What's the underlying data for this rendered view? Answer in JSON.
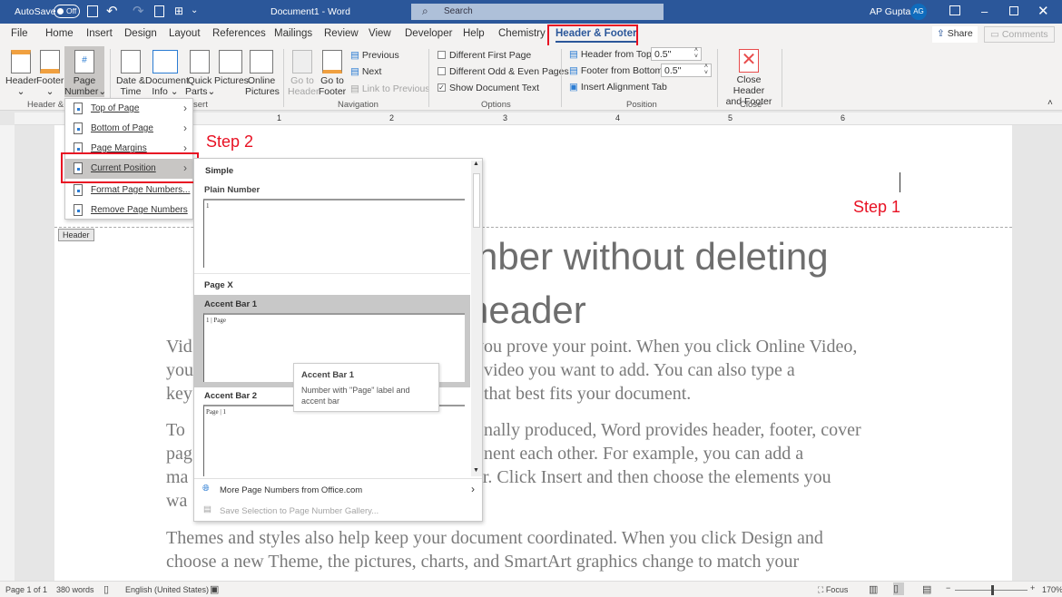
{
  "titlebar": {
    "autosave_label": "AutoSave",
    "autosave_state": "Off",
    "document_title": "Document1  -  Word",
    "search_placeholder": "Search",
    "user_name": "AP Gupta",
    "user_initials": "AG"
  },
  "tabs": [
    "File",
    "Home",
    "Insert",
    "Design",
    "Layout",
    "References",
    "Mailings",
    "Review",
    "View",
    "Developer",
    "Help",
    "Chemistry",
    "Header & Footer"
  ],
  "active_tab": "Header & Footer",
  "share_label": "Share",
  "comments_label": "Comments",
  "ribbon": {
    "header": "Header",
    "footer": "Footer",
    "page_number_1": "Page",
    "page_number_2": "Number",
    "date_time_1": "Date &",
    "date_time_2": "Time",
    "doc_info_1": "Document",
    "doc_info_2": "Info",
    "quick_parts_1": "Quick",
    "quick_parts_2": "Parts",
    "pictures": "Pictures",
    "online_pictures_1": "Online",
    "online_pictures_2": "Pictures",
    "go_header_1": "Go to",
    "go_header_2": "Header",
    "go_footer_1": "Go to",
    "go_footer_2": "Footer",
    "previous": "Previous",
    "next": "Next",
    "link_previous": "Link to Previous",
    "diff_first": "Different First Page",
    "diff_odd_even": "Different Odd & Even Pages",
    "show_doc_text": "Show Document Text",
    "header_from_top": "Header from Top:",
    "header_from_top_value": "0.5\"",
    "footer_from_bottom": "Footer from Bottom:",
    "footer_from_bottom_value": "0.5\"",
    "insert_alignment_tab": "Insert Alignment Tab",
    "close_1": "Close Header",
    "close_2": "and Footer",
    "groups": {
      "hf": "Header & F",
      "insert": "sert",
      "navigation": "Navigation",
      "options": "Options",
      "position": "Position",
      "close": "Close"
    },
    "options_checked": {
      "diff_first": false,
      "diff_odd_even": false,
      "show_doc_text": true
    }
  },
  "ruler_numbers": [
    "1",
    "2",
    "3",
    "4",
    "5",
    "6"
  ],
  "page_number_menu": [
    "Top of Page",
    "Bottom of Page",
    "Page Margins",
    "Current Position",
    "Format Page Numbers...",
    "Remove Page Numbers"
  ],
  "gallery": {
    "section1": "Simple",
    "item1": "Plain Number",
    "item1_preview": "1",
    "section2": "Page X",
    "item2": "Accent Bar 1",
    "item2_preview": "1 | Page",
    "item3": "Accent Bar 2",
    "item3_preview": "Page | 1",
    "more": "More Page Numbers from Office.com",
    "save": "Save Selection to Page Number Gallery..."
  },
  "tooltip": {
    "title": "Accent Bar 1",
    "desc": "Number with \"Page\" label and accent bar"
  },
  "annotations": {
    "step1": "Step 1",
    "step2": "Step 2"
  },
  "header_tag": "Header",
  "document": {
    "title_line1": "nber without deleting",
    "title_line2": "header",
    "p1": [
      [
        "Vid",
        "you prove your point. When you click Online Video,"
      ],
      [
        "you",
        "video you want to add. You can also type a"
      ],
      [
        "key",
        "that best fits your document."
      ]
    ],
    "p2": [
      [
        "To",
        "nally produced, Word provides header, footer, cover"
      ],
      [
        "pag",
        "nent each other. For example, you can add a"
      ],
      [
        "ma",
        "ar. Click Insert and then choose the elements you"
      ],
      [
        "wa",
        ""
      ]
    ],
    "p3": [
      "Themes and styles also help keep your document coordinated. When you click Design and",
      "choose a new Theme, the pictures, charts, and SmartArt graphics change to match your"
    ]
  },
  "status": {
    "page": "Page 1 of 1",
    "words": "380 words",
    "language": "English (United States)",
    "focus": "Focus",
    "zoom": "170%"
  },
  "colors": {
    "title_bar": "#2b579a",
    "accent": "#2b579a",
    "annotation_red": "#e81123"
  }
}
